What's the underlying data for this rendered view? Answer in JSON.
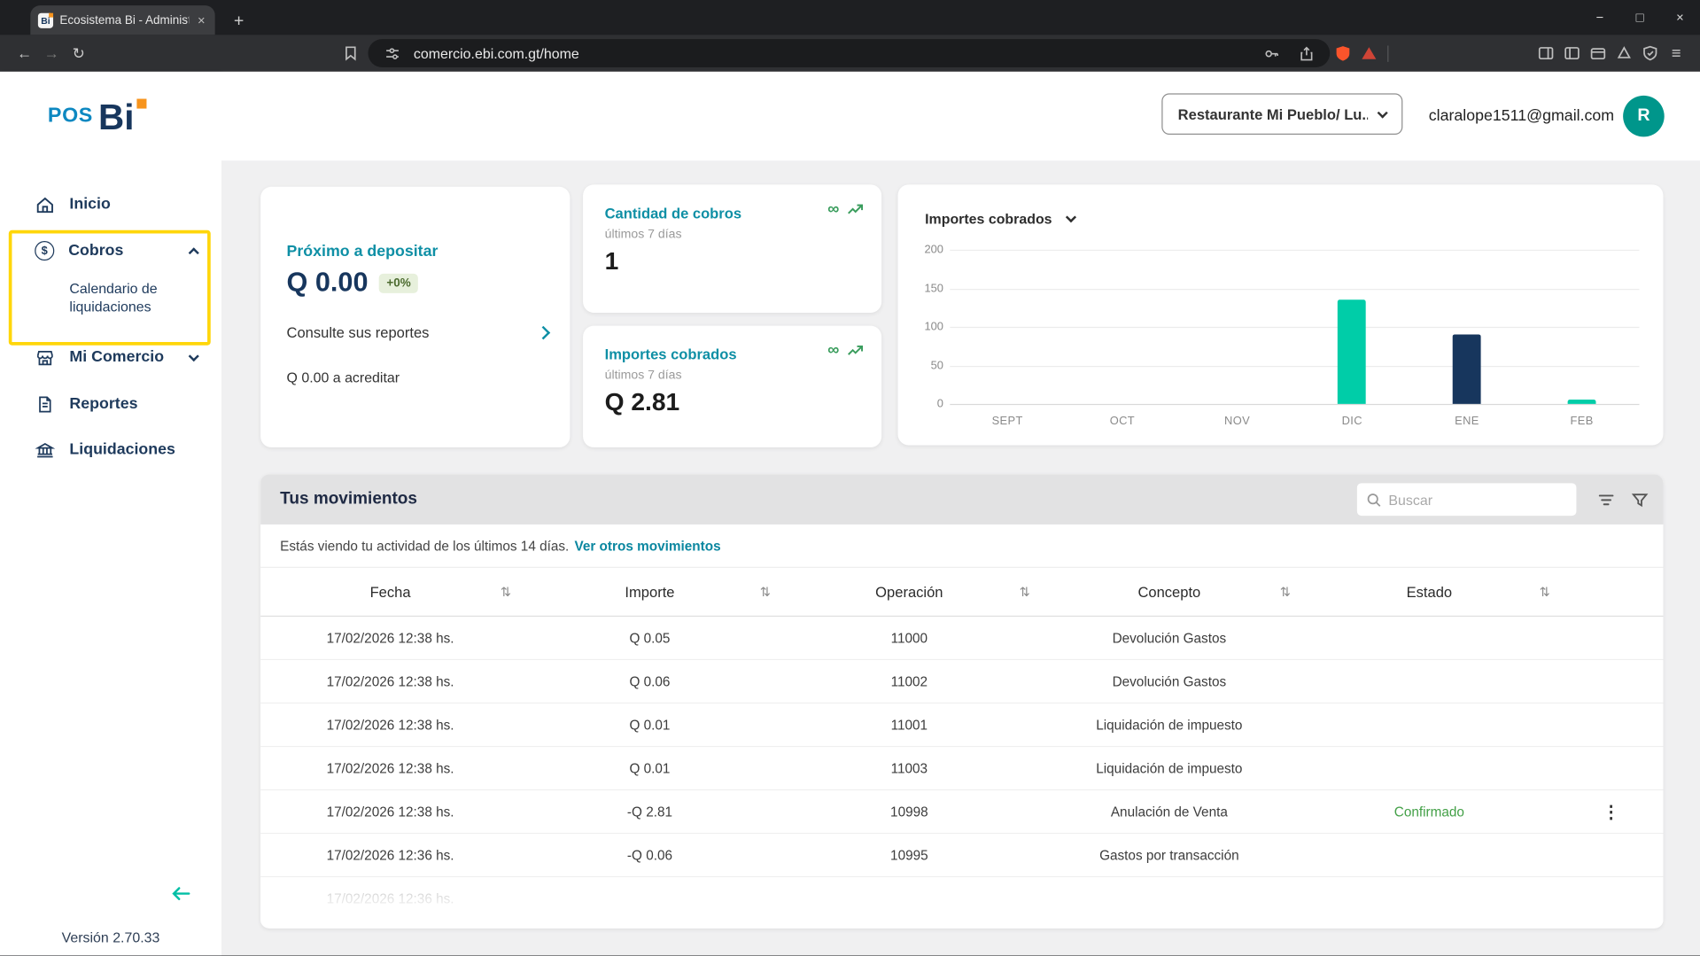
{
  "browser": {
    "tab_title": "Ecosistema Bi - Administrador",
    "favicon": "Bi",
    "url": "comercio.ebi.com.gt/home"
  },
  "icons": {
    "close": "×",
    "minimize": "−",
    "maximize": "□",
    "new_tab": "+",
    "back": "←",
    "forward": "→",
    "reload": "↻",
    "menu": "≡",
    "kebab": "⋮",
    "sort": "⇅",
    "infinity": "∞",
    "dollar": "$"
  },
  "sidebar": {
    "logo_pos": "POS",
    "logo_bi": "Bi",
    "items": {
      "inicio": "Inicio",
      "cobros": "Cobros",
      "calendario": "Calendario de liquidaciones",
      "mi_comercio": "Mi Comercio",
      "reportes": "Reportes",
      "liquidaciones": "Liquidaciones"
    },
    "version": "Versión 2.70.33"
  },
  "header": {
    "merchant": "Restaurante Mi Pueblo/ Lu...",
    "email": "claralope1511@gmail.com",
    "avatar_initial": "R"
  },
  "cards": {
    "deposito": {
      "title": "Próximo a depositar",
      "amount": "Q 0.00",
      "badge": "+0%",
      "link": "Consulte sus reportes",
      "footnote": "Q 0.00 a acreditar"
    },
    "cantidad": {
      "title": "Cantidad de cobros",
      "subtitle": "últimos 7 días",
      "value": "1"
    },
    "importes": {
      "title": "Importes cobrados",
      "subtitle": "últimos 7 días",
      "value": "Q 2.81"
    }
  },
  "chart_data": {
    "type": "bar",
    "title": "Importes cobrados",
    "categories": [
      "SEPT",
      "OCT",
      "NOV",
      "DIC",
      "ENE",
      "FEB"
    ],
    "values": [
      0,
      0,
      0,
      135,
      90,
      5
    ],
    "bar_colors": [
      "#00CDA8",
      "#00CDA8",
      "#00CDA8",
      "#00CDA8",
      "#17365D",
      "#00CDA8"
    ],
    "ylim": [
      0,
      200
    ],
    "yticks": [
      0,
      50,
      100,
      150,
      200
    ],
    "grid": true,
    "legend": "none",
    "xlabel": "",
    "ylabel": ""
  },
  "movements": {
    "title": "Tus movimientos",
    "search_placeholder": "Buscar",
    "info_text": "Estás viendo tu actividad de los últimos 14 días.",
    "info_link": "Ver otros movimientos",
    "columns": [
      "Fecha",
      "Importe",
      "Operación",
      "Concepto",
      "Estado"
    ],
    "rows": [
      {
        "fecha": "17/02/2026 12:38 hs.",
        "importe": "Q 0.05",
        "operacion": "11000",
        "concepto": "Devolución Gastos",
        "estado": "",
        "menu": false
      },
      {
        "fecha": "17/02/2026 12:38 hs.",
        "importe": "Q 0.06",
        "operacion": "11002",
        "concepto": "Devolución Gastos",
        "estado": "",
        "menu": false
      },
      {
        "fecha": "17/02/2026 12:38 hs.",
        "importe": "Q 0.01",
        "operacion": "11001",
        "concepto": "Liquidación de impuesto",
        "estado": "",
        "menu": false
      },
      {
        "fecha": "17/02/2026 12:38 hs.",
        "importe": "Q 0.01",
        "operacion": "11003",
        "concepto": "Liquidación de impuesto",
        "estado": "",
        "menu": false
      },
      {
        "fecha": "17/02/2026 12:38 hs.",
        "importe": "-Q 2.81",
        "operacion": "10998",
        "concepto": "Anulación de Venta",
        "estado": "Confirmado",
        "menu": true
      },
      {
        "fecha": "17/02/2026 12:36 hs.",
        "importe": "-Q 0.06",
        "operacion": "10995",
        "concepto": "Gastos por transacción",
        "estado": "",
        "menu": false
      }
    ],
    "partial_row": {
      "fecha": "17/02/2026 12:36 hs.",
      "importe": "",
      "operacion": "",
      "concepto": "",
      "estado": "",
      "menu": false
    }
  },
  "colors": {
    "accent_teal": "#00BFA5",
    "brand_navy": "#17365D",
    "highlight_yellow": "#FFD60A",
    "confirmed_green": "#43A047",
    "link_teal": "#0B87A0",
    "bar_teal": "#00CDA8",
    "bar_navy": "#17365D",
    "badge_green_bg": "#E7F0DC"
  }
}
